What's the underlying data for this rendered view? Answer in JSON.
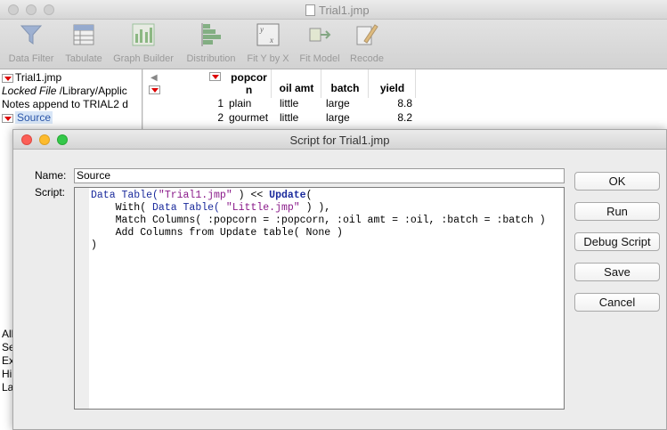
{
  "main_window": {
    "title": "Trial1.jmp",
    "toolbar": [
      {
        "label": "Data Filter",
        "icon": "data-filter-icon"
      },
      {
        "label": "Tabulate",
        "icon": "tabulate-icon"
      },
      {
        "label": "Graph Builder",
        "icon": "graph-builder-icon"
      },
      {
        "label": "Distribution",
        "icon": "distribution-icon"
      },
      {
        "label": "Fit Y by X",
        "icon": "fit-y-by-x-icon"
      },
      {
        "label": "Fit Model",
        "icon": "fit-model-icon"
      },
      {
        "label": "Recode",
        "icon": "recode-icon"
      }
    ],
    "left_panel": {
      "table_name": "Trial1.jmp",
      "locked_label": "Locked File",
      "locked_path": "/Library/Applic",
      "notes": "Notes  append to TRIAL2 d",
      "source_item": "Source",
      "partial_items": [
        "All",
        "Se",
        "Ex",
        "Hi",
        "La"
      ]
    },
    "grid": {
      "columns": [
        "popcorn",
        "oil amt",
        "batch",
        "yield"
      ],
      "column_line1": "popcor",
      "column_line2": "n",
      "rows": [
        {
          "num": "1",
          "popcorn": "plain",
          "oil": "little",
          "batch": "large",
          "yield": "8.8"
        },
        {
          "num": "2",
          "popcorn": "gourmet",
          "oil": "little",
          "batch": "large",
          "yield": "8.2"
        }
      ]
    }
  },
  "dialog": {
    "title": "Script for Trial1.jmp",
    "name_label": "Name:",
    "name_value": "Source",
    "script_label": "Script:",
    "script_lines": {
      "l1_a": "Data Table(",
      "l1_b": "\"Trial1.jmp\"",
      "l1_c": " ) << ",
      "l1_d": "Update",
      "l1_e": "(",
      "l2_a": "    With(",
      "l2_b": " Data Table(",
      "l2_c": " \"Little.jmp\"",
      "l2_d": " ) ),",
      "l3": "    Match Columns( :popcorn = :popcorn, :oil amt = :oil, :batch = :batch )",
      "l4": "    Add Columns from Update table( None )",
      "l5": ")"
    },
    "buttons": {
      "ok": "OK",
      "run": "Run",
      "debug": "Debug Script",
      "save": "Save",
      "cancel": "Cancel"
    }
  },
  "colors": {
    "close": "#fc5f57",
    "minimize": "#fdbb2d",
    "zoom": "#34c84a",
    "keyword": "#1a2a9c",
    "string": "#8a1a8a"
  }
}
